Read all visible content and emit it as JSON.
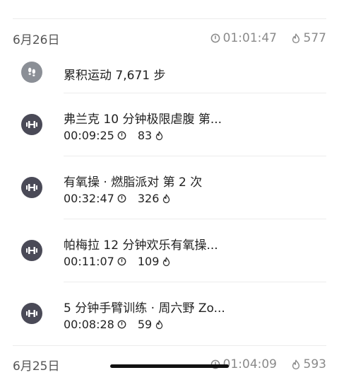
{
  "days": [
    {
      "date": "6月26日",
      "total_duration": "01:01:47",
      "total_kcal": "577",
      "steps_summary": "累积运动 7,671 步",
      "workouts": [
        {
          "title": "弗兰克 10 分钟极限虐腹  第...",
          "duration": "00:09:25",
          "kcal": "83"
        },
        {
          "title": "有氧操 · 燃脂派对  第 2 次",
          "duration": "00:32:47",
          "kcal": "326"
        },
        {
          "title": "帕梅拉 12 分钟欢乐有氧操...",
          "duration": "00:11:07",
          "kcal": "109"
        },
        {
          "title": "5 分钟手臂训练 · 周六野 Zo...",
          "duration": "00:08:28",
          "kcal": "59"
        }
      ]
    },
    {
      "date": "6月25日",
      "total_duration": "01:04:09",
      "total_kcal": "593"
    }
  ],
  "icons": {
    "clock": "clock-icon",
    "flame": "flame-icon",
    "footprints": "footprints-icon",
    "dumbbell": "dumbbell-icon"
  },
  "colors": {
    "icon_circle": "#4a4a57",
    "muted_text": "#8a8a8a",
    "divider": "#ececec"
  }
}
